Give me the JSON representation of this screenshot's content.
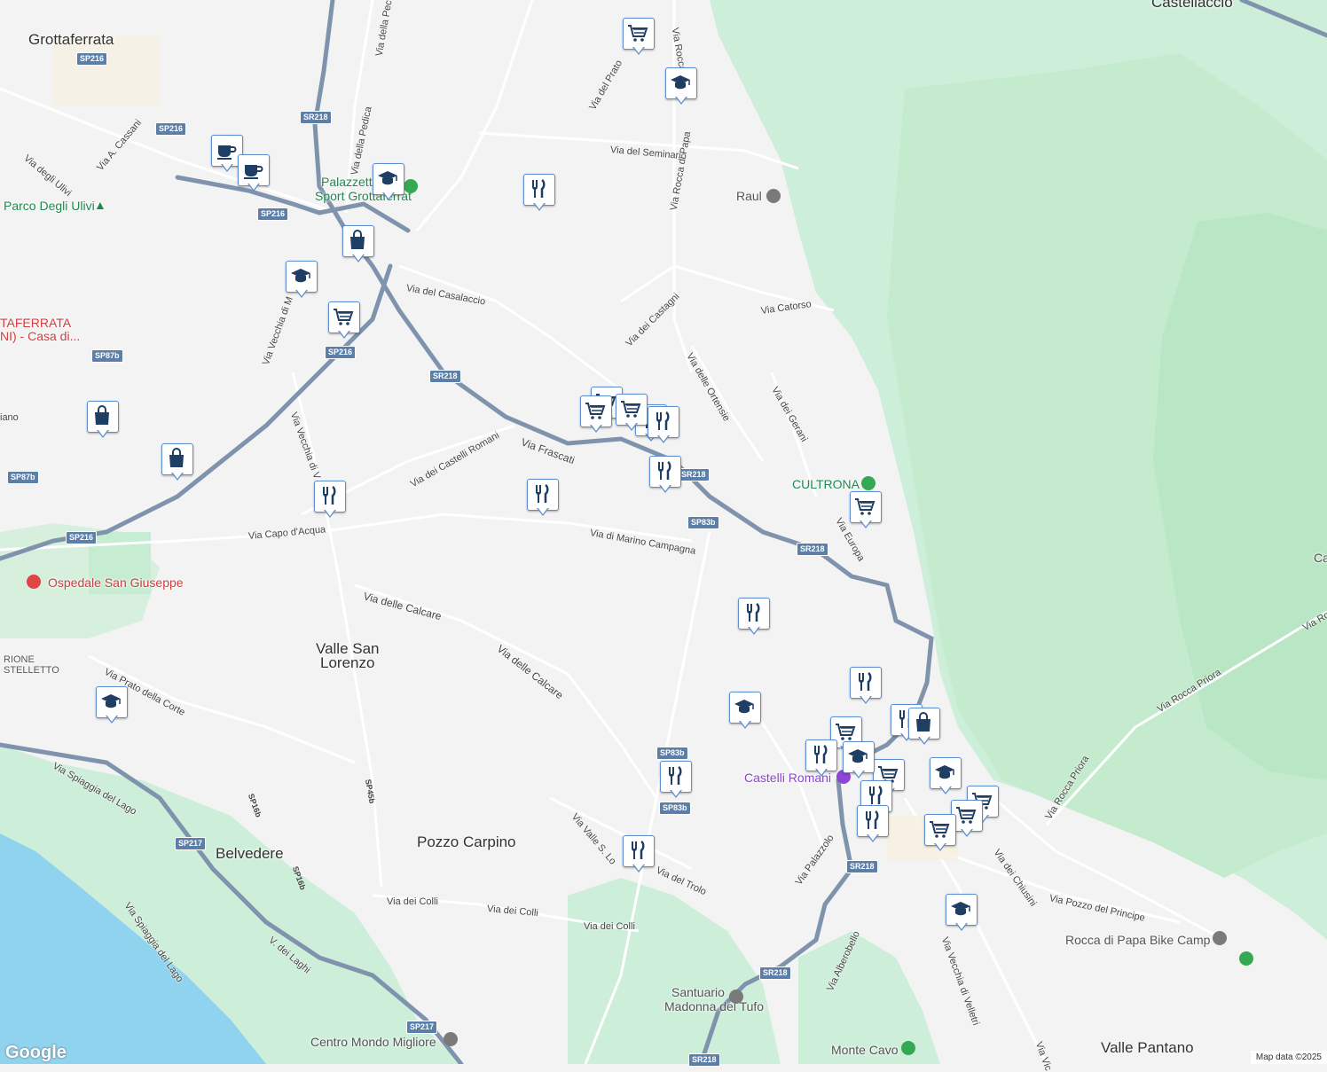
{
  "places": {
    "grottaferrata": "Grottaferrata",
    "castellaccio": "Castellaccio",
    "valle_san_lorenzo_1": "Valle San",
    "valle_san_lorenzo_2": "Lorenzo",
    "belvedere": "Belvedere",
    "pozzo_carpino": "Pozzo Carpino",
    "valle_pantano": "Valle Pantano",
    "rione_1": "RIONE",
    "rione_2": "STELLETTO"
  },
  "pois": {
    "palazzetto_1": "Palazzetto",
    "palazzetto_2": "Sport Grottaferrat",
    "parco_ulivi": "Parco Degli Ulivi",
    "raul": "Raul",
    "cultrona": "CULTRONA",
    "ospedale": "Ospedale San Giuseppe",
    "castelli_romani": "Castelli Romani",
    "santuario_1": "Santuario",
    "santuario_2": "Madonna del Tufo",
    "centro_mondo": "Centro Mondo Migliore",
    "monte_cavo": "Monte Cavo",
    "rocca_bike": "Rocca di Papa Bike Camp",
    "taferrata_1": "TAFERRATA",
    "taferrata_2": "NI) -  Casa di...",
    "ca_partial": "Ca"
  },
  "roads": {
    "via_della_pedica": "Via della Pedica",
    "via_della_pec": "Via della Pec",
    "via_del_prato": "Via del Prato",
    "via_rocca_top": "Via Rocca",
    "via_del_seminario": "Via del Seminario",
    "via_rocca_di_papa": "Via Rocca di Papa",
    "via_a_cassani": "Via A. Cassani",
    "via_degli_ulivi": "Via degli Ulivi",
    "via_del_casalaccio": "Via del Casalaccio",
    "via_dei_castagni": "Via dei Castagni",
    "via_catorso": "Via Catorso",
    "via_delle_ortensie": "Via delle Ortensie",
    "via_dei_gerani": "Via dei Gerani",
    "via_vecchia_di_m": "Via Vecchia di M",
    "via_vecchia_di_v": "Via Vecchia di V",
    "via_frascati": "Via Frascati",
    "via_dei_castelli": "Via dei Castelli Romani",
    "via_di_marino": "Via di Marino Campagna",
    "via_capo_acqua": "Via Capo d'Acqua",
    "via_delle_calcare_1": "Via delle Calcare",
    "via_delle_calcare_2": "Via delle Calcare",
    "via_prato_corte": "Via Prato della Corte",
    "via_spiaggia_1": "Via Spiaggia del Lago",
    "via_spiaggia_2": "Via Spiaggia del Lago",
    "via_europa": "Via Europa",
    "via_valle": "Via Valle S. Lo",
    "via_del_trolo": "Via del Trolo",
    "via_dei_colli_1": "Via dei Colli",
    "via_dei_colli_2": "Via dei Colli",
    "via_dei_colli_3": "Via dei Colli",
    "via_palazzolo": "Via Palazzolo",
    "via_alberobello": "Via Alberobello",
    "via_vecchia_velletri": "Via Vecchia di Velletri",
    "via_dei_chiusini": "Via dei Chiusini",
    "via_pozzo": "Via Pozzo del Principe",
    "via_rocca_priora_1": "Via Rocca Priora",
    "via_rocca_priora_2": "Via Rocca Priora",
    "via_dei_laghi": "V. dei Laghi",
    "via_vic": "Via Vic",
    "via_ro": "Via Ro",
    "iano": "iano"
  },
  "shields": {
    "sp216_a": "SP216",
    "sp216_b": "SP216",
    "sp216_c": "SP216",
    "sp216_d": "SP216",
    "sp216_e": "SP216",
    "sr218_a": "SR218",
    "sr218_b": "SR218",
    "sr218_c": "SR218",
    "sr218_d": "SR218",
    "sr218_e": "SR218",
    "sr218_f": "SR218",
    "sr218_g": "SR218",
    "sp87b_a": "SP87b",
    "sp87b_b": "SP87b",
    "sp83b_a": "SP83b",
    "sp83b_b": "SP83b",
    "sp83b_c": "SP83b",
    "sp217_a": "SP217",
    "sp217_b": "SP217",
    "sp16b": "SP16b",
    "sp16b_2": "SP16b",
    "sp45b": "SP45b"
  },
  "branding": {
    "logo": "Google",
    "attribution": "Map data ©2025"
  },
  "colors": {
    "water": "#8fd3ef",
    "forest": "#c6ecd2",
    "road_major": "#7f93ad",
    "marker_border": "#5c8ed1",
    "marker_icon": "#1f3e63",
    "park_green": "#34a853"
  },
  "markers": [
    {
      "icon": "cart-icon"
    },
    {
      "icon": "school-icon"
    },
    {
      "icon": "cafe-icon"
    },
    {
      "icon": "cafe-icon"
    },
    {
      "icon": "school-icon"
    },
    {
      "icon": "restaurant-icon"
    },
    {
      "icon": "shopping-bag-icon"
    },
    {
      "icon": "school-icon"
    },
    {
      "icon": "cart-icon"
    },
    {
      "icon": "shopping-bag-icon"
    },
    {
      "icon": "shopping-bag-icon"
    },
    {
      "icon": "restaurant-icon"
    },
    {
      "icon": "cart-icon"
    },
    {
      "icon": "cart-icon"
    },
    {
      "icon": "restaurant-icon"
    },
    {
      "icon": "restaurant-icon"
    },
    {
      "icon": "restaurant-icon"
    },
    {
      "icon": "restaurant-icon"
    },
    {
      "icon": "cart-icon"
    },
    {
      "icon": "restaurant-icon"
    },
    {
      "icon": "school-icon"
    },
    {
      "icon": "school-icon"
    },
    {
      "icon": "restaurant-icon"
    },
    {
      "icon": "restaurant-icon"
    },
    {
      "icon": "cart-icon"
    },
    {
      "icon": "restaurant-icon"
    },
    {
      "icon": "shopping-bag-icon"
    },
    {
      "icon": "restaurant-icon"
    },
    {
      "icon": "cart-icon"
    },
    {
      "icon": "school-icon"
    },
    {
      "icon": "cart-icon"
    },
    {
      "icon": "restaurant-icon"
    },
    {
      "icon": "school-icon"
    },
    {
      "icon": "cart-icon"
    },
    {
      "icon": "cart-icon"
    },
    {
      "icon": "restaurant-icon"
    },
    {
      "icon": "restaurant-icon"
    },
    {
      "icon": "cart-icon"
    },
    {
      "icon": "school-icon"
    }
  ]
}
